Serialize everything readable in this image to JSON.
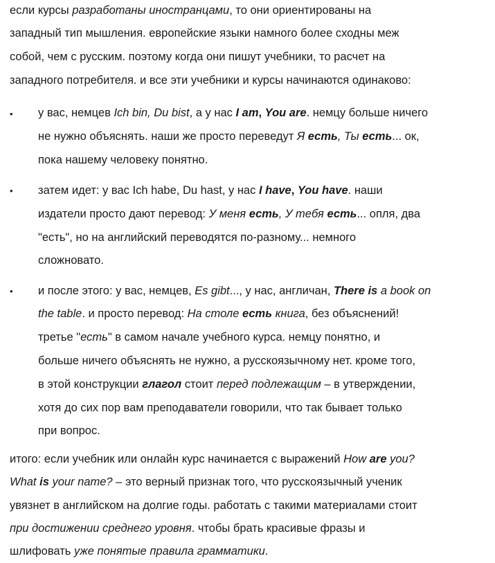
{
  "intro": {
    "l1": [
      "если курсы ",
      "разработаны иностранцами",
      ", то они ориентированы на"
    ],
    "l2": "западный тип мышления. европейские языки намного более сходны меж",
    "l3": "собой, чем с русским. поэтому когда они пишут учебники, то расчет на",
    "l4": "западного потребителя. и все эти учебники и курсы начинаются одинаково:"
  },
  "bullet_glyph": "•",
  "item1": {
    "l1": [
      "у вас, немцев ",
      "Ich bin, Du bist",
      ", а у нас ",
      "I am",
      ", ",
      "You are",
      ". немцу больше ничего"
    ],
    "l2": [
      "не нужно объяснять. наши же просто переведут ",
      "Я ",
      "есть",
      ", ",
      "Ты ",
      "есть",
      "... ок,"
    ],
    "l3": "пока нашему человеку понятно."
  },
  "item2": {
    "l1": [
      "затем идет: у вас Ich habe, Du hast, у нас ",
      "I have",
      ", ",
      "You have",
      ". наши"
    ],
    "l2": [
      "издатели просто дают перевод: ",
      "У меня ",
      "есть",
      ", ",
      "У тебя ",
      "есть",
      "... опля, два"
    ],
    "l3": "\"есть\", но на английский переводятся по-разному... немного",
    "l4": "сложновато."
  },
  "item3": {
    "l1": [
      "и после этого: у вас, немцев, ",
      "Es gibt",
      "..., у нас, англичан, ",
      "There is",
      " ",
      "a book on"
    ],
    "l2": [
      "the table",
      ". и просто перевод: ",
      "На столе ",
      "есть",
      " ",
      "книга",
      ", без объяснений!"
    ],
    "l3": [
      "третье \"",
      "есть",
      "\" в самом начале учебного курса. немцу понятно, и"
    ],
    "l4": "больше ничего объяснять не нужно, а русскоязычному нет. кроме того,",
    "l5": [
      "в этой конструкции ",
      "глагол",
      " стоит ",
      "перед подлежащим",
      " – в утверждении,"
    ],
    "l6": "хотя до сих пор вам преподаватели говорили, что так бывает только",
    "l7": "при вопрос."
  },
  "outro": {
    "l1": [
      "итого: если учебник или онлайн курс начинается с выражений ",
      "How ",
      "are",
      " you?"
    ],
    "l2": [
      "What ",
      "is",
      " your name?",
      " – это верный признак того, что русскоязычный ученик"
    ],
    "l3": "увязнет в английском на долгие годы. работать с такими материалами стоит",
    "l4": [
      "при достижении среднего уровня",
      ". чтобы брать красивые фразы и"
    ],
    "l5": [
      "шлифовать ",
      "уже понятые правила грамматики",
      "."
    ]
  }
}
